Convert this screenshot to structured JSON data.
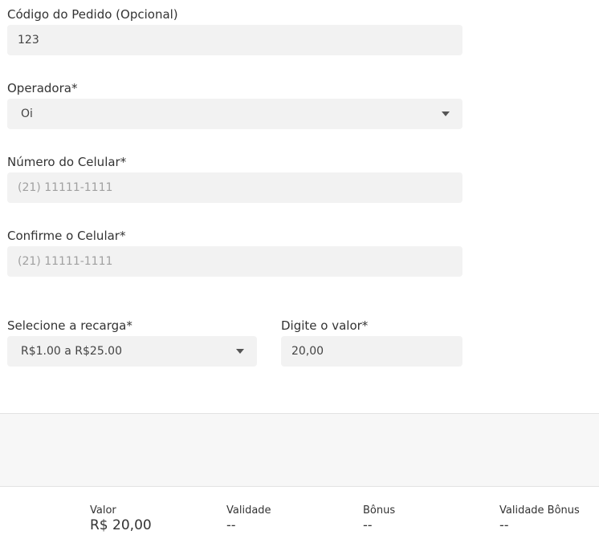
{
  "form": {
    "order_code": {
      "label": "Código do Pedido (Opcional)",
      "value": "123"
    },
    "operator": {
      "label": "Operadora*",
      "selected": "Oi"
    },
    "phone": {
      "label": "Número do Celular*",
      "placeholder": "(21) 11111-1111"
    },
    "confirm_phone": {
      "label": "Confirme o Celular*",
      "placeholder": "(21) 11111-1111"
    },
    "recharge": {
      "label": "Selecione a recarga*",
      "selected": "R$1.00 a R$25.00"
    },
    "amount": {
      "label": "Digite o valor*",
      "value": "20,00"
    }
  },
  "summary": {
    "valor": {
      "label": "Valor",
      "value": "R$ 20,00"
    },
    "validade": {
      "label": "Validade",
      "value": "--"
    },
    "bonus": {
      "label": "Bônus",
      "value": "--"
    },
    "validade_bonus": {
      "label": "Validade Bônus",
      "value": "--"
    }
  }
}
